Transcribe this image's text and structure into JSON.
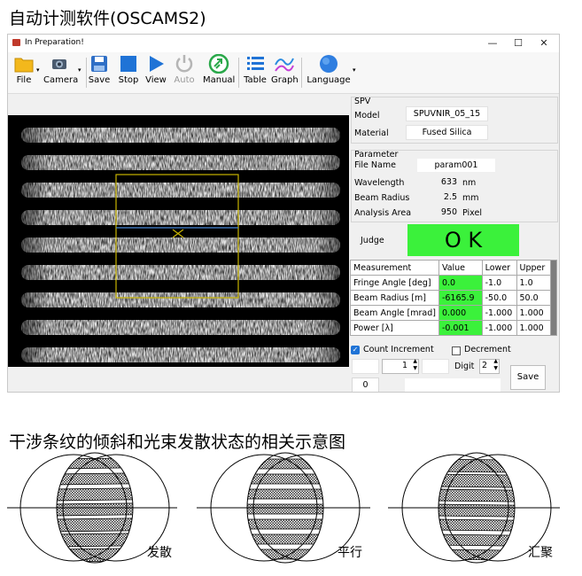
{
  "heading_top": "自动计测软件(OSCAMS2)",
  "window": {
    "title": "In Preparation!",
    "controls": {
      "minimize": "—",
      "maximize": "☐",
      "close": "✕"
    }
  },
  "toolbar": {
    "items": [
      {
        "label": "File",
        "icon": "folder-icon"
      },
      {
        "label": "Camera",
        "icon": "camera-icon"
      },
      {
        "label": "Save",
        "icon": "save-icon"
      },
      {
        "label": "Stop",
        "icon": "stop-icon"
      },
      {
        "label": "View",
        "icon": "play-icon"
      },
      {
        "label": "Auto",
        "icon": "power-icon"
      },
      {
        "label": "Manual",
        "icon": "manual-icon"
      },
      {
        "label": "Table",
        "icon": "table-icon"
      },
      {
        "label": "Graph",
        "icon": "graph-icon"
      },
      {
        "label": "Language",
        "icon": "globe-icon"
      }
    ]
  },
  "spv": {
    "title": "SPV",
    "model_label": "Model",
    "model_value": "SPUVNIR_05_15",
    "material_label": "Material",
    "material_value": "Fused Silica"
  },
  "parameter": {
    "title": "Parameter",
    "file_name_label": "File Name",
    "file_name_value": "param001",
    "wavelength_label": "Wavelength",
    "wavelength_value": "633",
    "wavelength_unit": "nm",
    "beam_radius_label": "Beam Radius",
    "beam_radius_value": "2.5",
    "beam_radius_unit": "mm",
    "analysis_area_label": "Analysis Area",
    "analysis_area_value": "950",
    "analysis_area_unit": "Pixel"
  },
  "judge": {
    "label": "Judge",
    "value": "O K",
    "color": "#3bf13b"
  },
  "measurements": {
    "headers": [
      "Measurement",
      "Value",
      "Lower",
      "Upper"
    ],
    "rows": [
      [
        "Fringe Angle [deg]",
        "0.0",
        "-1.0",
        "1.0"
      ],
      [
        "Beam Radius [m]",
        "-6165.9",
        "-50.0",
        "50.0"
      ],
      [
        "Beam Angle [mrad]",
        "0.000",
        "-1.000",
        "1.000"
      ],
      [
        "Power [λ]",
        "-0.001",
        "-1.000",
        "1.000"
      ]
    ]
  },
  "controls": {
    "count_increment": "Count Increment",
    "count_increment_checked": true,
    "decrement": "Decrement",
    "decrement_checked": false,
    "spin1_value": "1",
    "digit_label": "Digit",
    "digit_value": "2",
    "counter_value": "0",
    "save_button": "Save"
  },
  "heading_bottom": "干涉条纹的倾斜和光束发散状态的相关示意图",
  "diagrams": {
    "labels": [
      "发散",
      "平行",
      "汇聚"
    ]
  },
  "colors": {
    "accent_green": "#3bf13b",
    "roi_yellow": "#c8b400",
    "roi_line": "#4a8ad8"
  }
}
